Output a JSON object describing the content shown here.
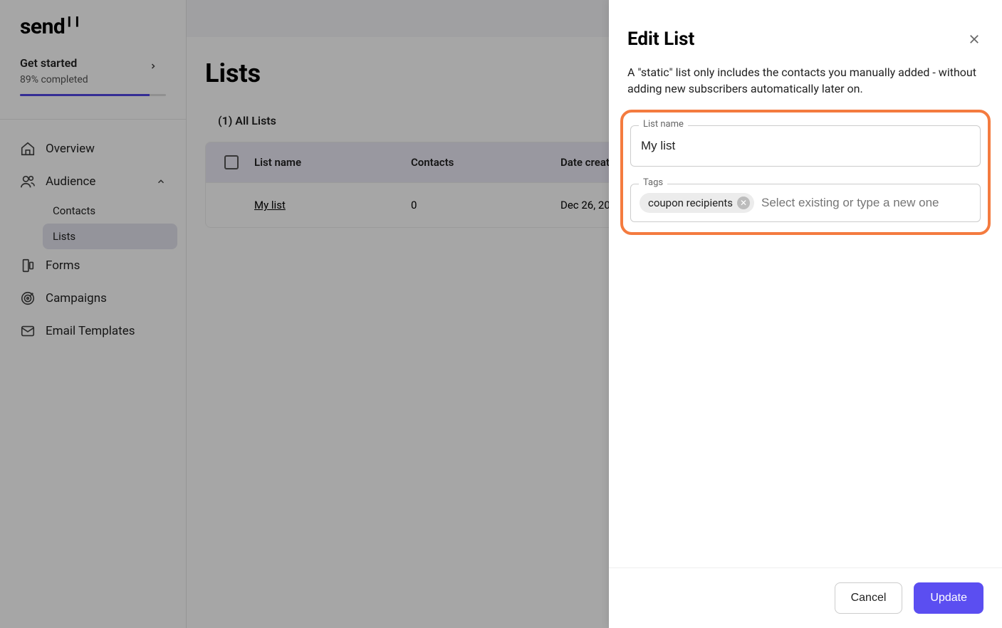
{
  "logo": "send",
  "get_started": {
    "title": "Get started",
    "completion_text": "89% completed",
    "completion_pct": 89
  },
  "nav": {
    "overview": "Overview",
    "audience": "Audience",
    "audience_sub": {
      "contacts": "Contacts",
      "lists": "Lists"
    },
    "forms": "Forms",
    "campaigns": "Campaigns",
    "email_templates": "Email Templates"
  },
  "main": {
    "title": "Lists",
    "tab_label": "(1) All Lists",
    "columns": {
      "name": "List name",
      "contacts": "Contacts",
      "date": "Date created"
    },
    "rows": [
      {
        "name": "My list",
        "contacts": "0",
        "date": "Dec 26, 20"
      }
    ]
  },
  "panel": {
    "title": "Edit List",
    "description": "A \"static\" list only includes the contacts you manually added - without adding new subscribers automatically later on.",
    "fields": {
      "list_name_label": "List name",
      "list_name_value": "My list",
      "tags_label": "Tags",
      "tags_placeholder": "Select existing or type a new one",
      "tags": [
        "coupon recipients"
      ]
    },
    "buttons": {
      "cancel": "Cancel",
      "update": "Update"
    }
  }
}
